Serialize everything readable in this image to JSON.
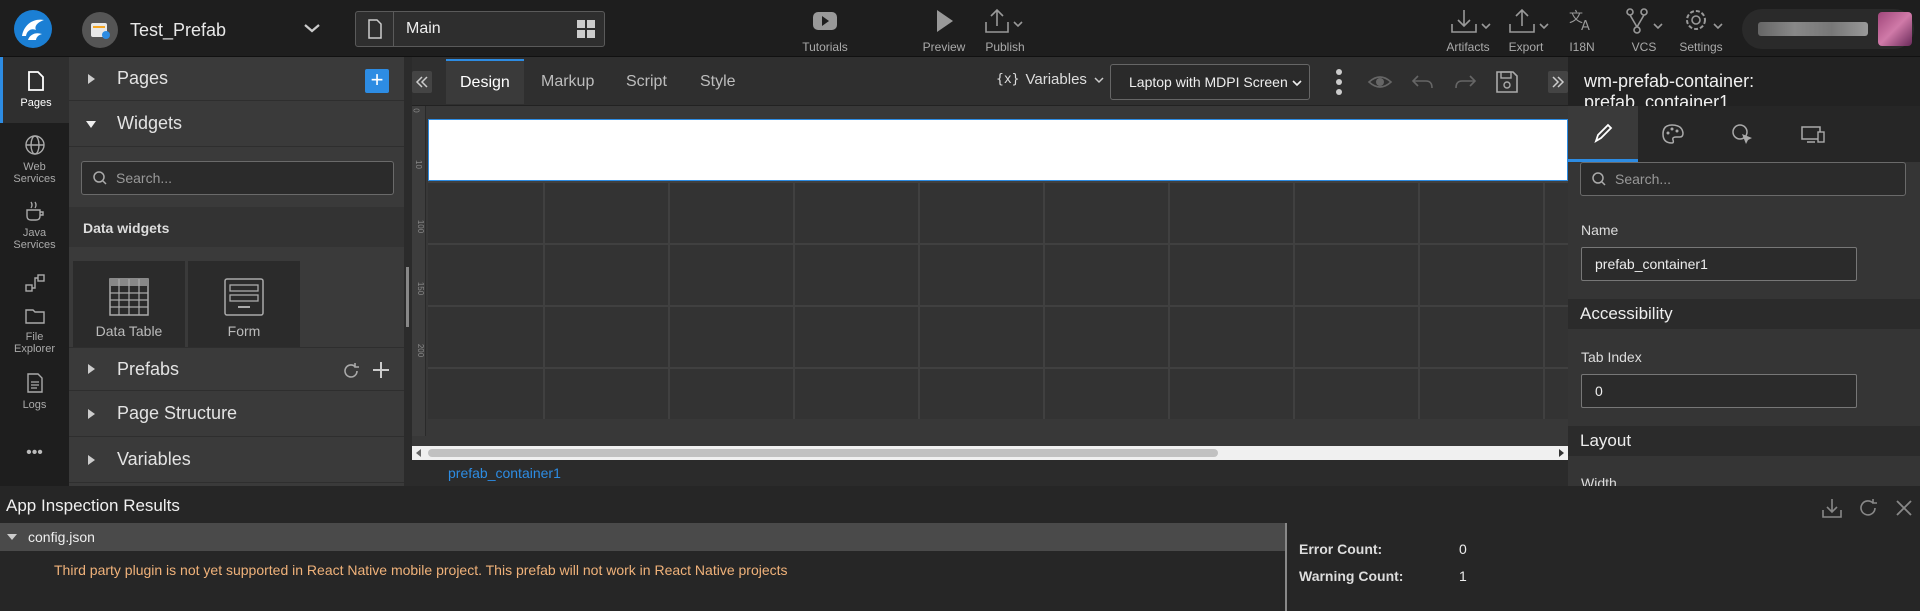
{
  "project": {
    "name": "Test_Prefab"
  },
  "page_selector": {
    "value": "Main"
  },
  "toolbar": {
    "tutorials": "Tutorials",
    "preview": "Preview",
    "publish": "Publish",
    "artifacts": "Artifacts",
    "export": "Export",
    "i18n": "I18N",
    "vcs": "VCS",
    "settings": "Settings"
  },
  "rail": {
    "pages": "Pages",
    "web_services": [
      "Web",
      "Services"
    ],
    "java_services": [
      "Java",
      "Services"
    ],
    "file_explorer": [
      "File",
      "Explorer"
    ],
    "logs": "Logs",
    "more": "•••"
  },
  "left_panel": {
    "pages": "Pages",
    "widgets": "Widgets",
    "search_placeholder": "Search...",
    "data_widgets": "Data widgets",
    "tiles": [
      "Data Table",
      "Form"
    ],
    "prefabs": "Prefabs",
    "page_structure": "Page Structure",
    "variables": "Variables"
  },
  "editor": {
    "tabs": [
      "Design",
      "Markup",
      "Script",
      "Style"
    ],
    "variables_label": "Variables",
    "device": "Laptop with MDPI Screen",
    "ruler_ticks": [
      "0",
      "10",
      "100",
      "150",
      "200"
    ],
    "breadcrumb": "prefab_container1"
  },
  "right_panel": {
    "title": "wm-prefab-container: prefab_container1",
    "search_placeholder": "Search...",
    "name_label": "Name",
    "name_value": "prefab_container1",
    "accessibility": "Accessibility",
    "tab_index_label": "Tab Index",
    "tab_index_value": "0",
    "layout": "Layout",
    "width_label": "Width"
  },
  "inspection": {
    "title": "App Inspection Results",
    "file": "config.json",
    "message": "Third party plugin is not yet supported in React Native mobile project. This prefab will not work in React Native projects",
    "error_label": "Error Count:",
    "error_value": "0",
    "warning_label": "Warning Count:",
    "warning_value": "1"
  },
  "colors": {
    "accent": "#2d8ce3",
    "warning_text": "#f0b27a"
  }
}
